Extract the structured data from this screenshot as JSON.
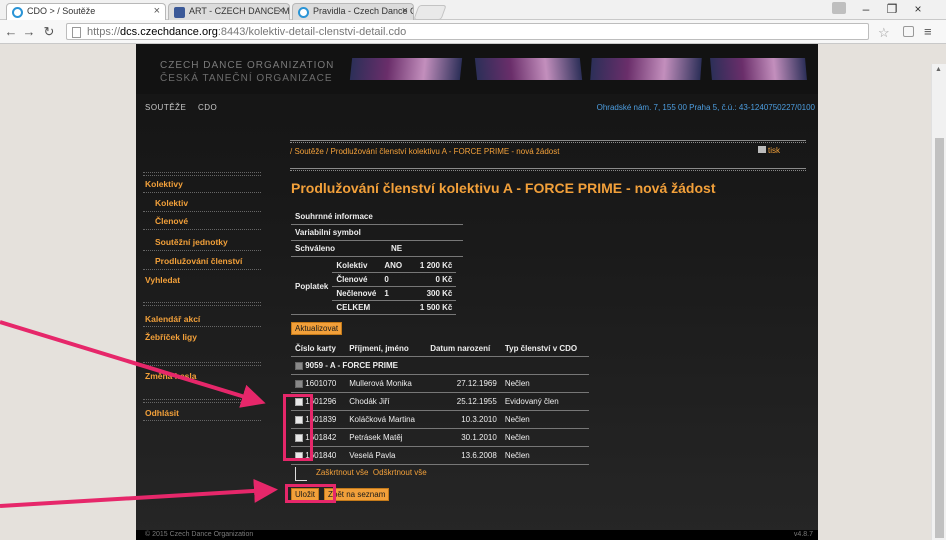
{
  "browser": {
    "tabs": [
      {
        "title": "CDO > / Soutěže"
      },
      {
        "title": "ART - CZECH DANCE MAS"
      },
      {
        "title": "Pravidla - Czech Dance O"
      }
    ],
    "url_prefix": "https://",
    "url_host": "dcs.czechdance.org",
    "url_path": ":8443/kolektiv-detail-clenstvi-detail.cdo"
  },
  "site": {
    "org_line1": "CZECH DANCE ORGANIZATION",
    "org_line2": "ČESKÁ TANEČNÍ ORGANIZACE",
    "nav": [
      "SOUTĚŽE",
      "CDO"
    ],
    "address": "Ohradské nám. 7, 155 00 Praha 5, č.ú.: 43-1240750227/0100",
    "breadcrumb": "/ Soutěže / Prodlužování členství kolektivu A - FORCE PRIME - nová žádost",
    "print_label": "tisk",
    "footer_copy": "© 2015 Czech Dance Organization",
    "footer_version": "v4.8.7"
  },
  "sidebar": {
    "kolektivy": "Kolektivy",
    "kolektiv": "Kolektiv",
    "clenove": "Členové",
    "soutezni_jednotky": "Soutěžní jednotky",
    "prodluzovani": "Prodlužování členství",
    "vyhledat": "Vyhledat",
    "kalendar": "Kalendář akcí",
    "zebricek": "Žebříček ligy",
    "zmena": "Změna hesla",
    "odhlasit": "Odhlásit"
  },
  "page": {
    "title": "Prodlužování členství kolektivu A - FORCE PRIME - nová žádost"
  },
  "summary": {
    "header": "Souhrnné informace",
    "variabilni_symbol": "Variabilní symbol",
    "schvaleno_label": "Schváleno",
    "schvaleno_value": "NE"
  },
  "fees": {
    "label": "Poplatek",
    "rows": [
      {
        "name": "Kolektiv",
        "qty": "ANO",
        "amount": "1 200 Kč"
      },
      {
        "name": "Členové",
        "qty": "0",
        "amount": "0 Kč"
      },
      {
        "name": "Nečlenové",
        "qty": "1",
        "amount": "300 Kč"
      },
      {
        "name": "CELKEM",
        "qty": "",
        "amount": "1 500 Kč"
      }
    ]
  },
  "buttons": {
    "update": "Aktualizovat",
    "save": "Uložit",
    "back": "Zpět na seznam"
  },
  "members": {
    "headers": [
      "Číslo karty",
      "Příjmení, jméno",
      "Datum narození",
      "Typ členství v CDO"
    ],
    "group": "9059 - A - FORCE PRIME",
    "rows": [
      {
        "card": "1601070",
        "name": "Mullerová Monika",
        "dob": "27.12.1969",
        "type": "Nečlen"
      },
      {
        "card": "1601296",
        "name": "Chodák Jiří",
        "dob": "25.12.1955",
        "type": "Evidovaný člen"
      },
      {
        "card": "1601839",
        "name": "Koláčková Martina",
        "dob": "10.3.2010",
        "type": "Nečlen"
      },
      {
        "card": "1601842",
        "name": "Petrásek Matěj",
        "dob": "30.1.2010",
        "type": "Nečlen"
      },
      {
        "card": "1601840",
        "name": "Veselá Pavla",
        "dob": "13.6.2008",
        "type": "Nečlen"
      }
    ],
    "select_all": "Zaškrtnout vše",
    "deselect_all": "Odškrtnout vše"
  },
  "colors": {
    "accent": "#f2a03a",
    "annotation": "#e6276a"
  }
}
